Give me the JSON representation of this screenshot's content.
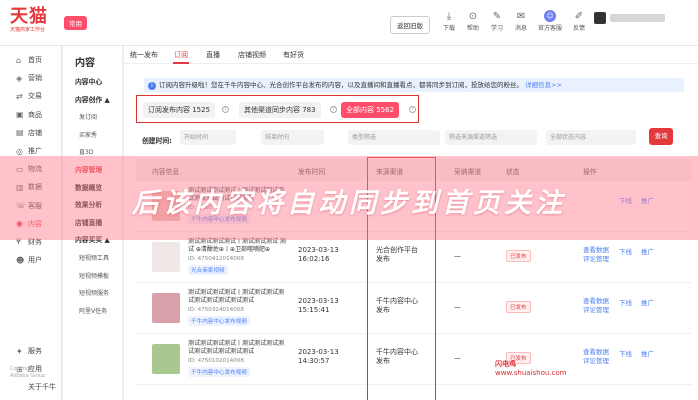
{
  "header": {
    "logo_main": "天猫",
    "logo_sub": "天猫商家工作台",
    "common_tag": "常用",
    "old_version_label": "返回旧版",
    "icons": [
      {
        "label": "下载",
        "glyph": "⤓",
        "icon": "download-icon"
      },
      {
        "label": "帮助",
        "glyph": "⊙",
        "icon": "help-icon"
      },
      {
        "label": "学习",
        "glyph": "✎",
        "icon": "learn-icon"
      },
      {
        "label": "消息",
        "glyph": "✉",
        "icon": "message-icon"
      },
      {
        "label": "官方客服",
        "glyph": "☺",
        "icon": "service-icon"
      },
      {
        "label": "反馈",
        "glyph": "✐",
        "icon": "feedback-icon"
      }
    ]
  },
  "sidebar": {
    "items": [
      {
        "label": "首页",
        "glyph": "⌂",
        "icon": "home-icon"
      },
      {
        "label": "营销",
        "glyph": "◈",
        "icon": "marketing-icon"
      },
      {
        "label": "交易",
        "glyph": "⇄",
        "icon": "trade-icon"
      },
      {
        "label": "商品",
        "glyph": "▣",
        "icon": "product-icon"
      },
      {
        "label": "店铺",
        "glyph": "▤",
        "icon": "store-icon"
      },
      {
        "label": "推广",
        "glyph": "◎",
        "icon": "promotion-icon"
      },
      {
        "label": "物流",
        "glyph": "▭",
        "icon": "logistics-icon"
      },
      {
        "label": "数据",
        "glyph": "▥",
        "icon": "data-icon"
      },
      {
        "label": "客服",
        "glyph": "☏",
        "icon": "customer-service-icon"
      },
      {
        "label": "内容",
        "glyph": "◉",
        "icon": "content-icon"
      },
      {
        "label": "财务",
        "glyph": "¥",
        "icon": "finance-icon"
      },
      {
        "label": "用户",
        "glyph": "☻",
        "icon": "user-icon"
      },
      {
        "label": "",
        "glyph": "",
        "icon": ""
      },
      {
        "label": "",
        "glyph": "",
        "icon": ""
      },
      {
        "label": "",
        "glyph": "",
        "icon": ""
      },
      {
        "label": "",
        "glyph": "",
        "icon": ""
      },
      {
        "label": "服务",
        "glyph": "✦",
        "icon": "service-icon"
      },
      {
        "label": "应用",
        "glyph": "⊞",
        "icon": "apps-icon"
      },
      {
        "label": "关于千牛",
        "glyph": "",
        "icon": ""
      }
    ],
    "active_index": 9,
    "copyright": "Copyright © Alibaba Group"
  },
  "subnav": {
    "title": "内容",
    "items": [
      {
        "label": "内容中心",
        "kind": "grp"
      },
      {
        "label": "内容创作 ▲",
        "kind": "grp"
      },
      {
        "label": "发订阅",
        "kind": "sub"
      },
      {
        "label": "买家秀",
        "kind": "sub"
      },
      {
        "label": "直3D",
        "kind": "sub"
      },
      {
        "label": "内容管理",
        "kind": "grp sel"
      },
      {
        "label": "数据概览",
        "kind": "grp"
      },
      {
        "label": "效果分析",
        "kind": "grp"
      },
      {
        "label": "店铺直播",
        "kind": "grp"
      },
      {
        "label": "内容买买 ▲",
        "kind": "grp"
      },
      {
        "label": "短视频工具",
        "kind": "sub"
      },
      {
        "label": "短视频模板",
        "kind": "sub"
      },
      {
        "label": "短视频服务",
        "kind": "sub"
      },
      {
        "label": "阿里V任务",
        "kind": "sub"
      }
    ]
  },
  "tabs": [
    "统一发布",
    "订阅",
    "直播",
    "店铺视频",
    "有好货"
  ],
  "notice": {
    "text": "订阅内容升级啦！您在千牛内容中心、光合创作平台发布的内容，以及直播间和直播看点，都将同步到订阅，投放给您的粉丝。",
    "link": "详细信息>>"
  },
  "filters": {
    "subscribe_count": "订阅发布内容 1525",
    "other_channel": "其他渠道同步内容 783",
    "all_content": "全部内容 5562"
  },
  "search": {
    "created_label": "创建时间:",
    "start_placeholder": "开始时间",
    "end_placeholder": "结束时间",
    "type_placeholder": "类型筛选",
    "channel_placeholder": "筛选来源渠道筛选",
    "status_placeholder": "全部状态内容",
    "button": "查询"
  },
  "table": {
    "headers": [
      "内容信息",
      "发布时间",
      "来源渠道",
      "采纳渠道",
      "状态",
      "操作"
    ],
    "rows": [
      {
        "title": "测试测试测试测试丨测试测试测试测试测试测试测试测试测试",
        "id": "ID: 4750...",
        "tag": "千牛内容中心发布视频",
        "date": "",
        "time": "",
        "source": "",
        "source2": "",
        "sync": "",
        "status": "",
        "act1": "",
        "act1b": "",
        "act2": "下线",
        "act3": "推广",
        "thumb_color": "#e8c4b8"
      },
      {
        "title": "测试测试测试测试丨测试测试测试 测试 ⊕清酣佐⊕丨⊕卫部嗤嘀肥⊕",
        "id": "ID: 4750412014008",
        "tag": "光合商家视频",
        "date": "2023-03-13",
        "time": "16:02:16",
        "source": "光合创作平台",
        "source2": "发布",
        "sync": "—",
        "status": "已发布",
        "act1": "查看数据",
        "act1b": "评论管理",
        "act2": "下线",
        "act3": "推广",
        "thumb_color": "#f0e8e6"
      },
      {
        "title": "测试测试测试测试丨测试测试测试测试测试测试测试测试测试",
        "id": "ID: 4750324014008",
        "tag": "千牛内容中心发布视频",
        "date": "2023-03-13",
        "time": "15:15:41",
        "source": "千牛内容中心",
        "source2": "发布",
        "sync": "—",
        "status": "已发布",
        "act1": "查看数据",
        "act1b": "评论管理",
        "act2": "下线",
        "act3": "推广",
        "thumb_color": "#d8a0a8"
      },
      {
        "title": "测试测试测试测试丨测试测试测试测试测试测试测试测试测试",
        "id": "ID: 4750102014008",
        "tag": "千牛内容中心发布视频",
        "date": "2023-03-13",
        "time": "14:30:57",
        "source": "千牛内容中心",
        "source2": "发布",
        "sync": "—",
        "status": "已发布",
        "act1": "查看数据",
        "act1b": "评论管理",
        "act2": "下线",
        "act3": "推广",
        "thumb_color": "#a8c890"
      }
    ]
  },
  "overlay": {
    "banner_text": "后该内容将自动同步到首页关注",
    "watermark_name": "闪电鸡",
    "watermark_url": "www.shuaishou.com"
  },
  "colors": {
    "brand": "#e4393c",
    "link": "#4a7ff2",
    "banner": "#ff788c"
  }
}
